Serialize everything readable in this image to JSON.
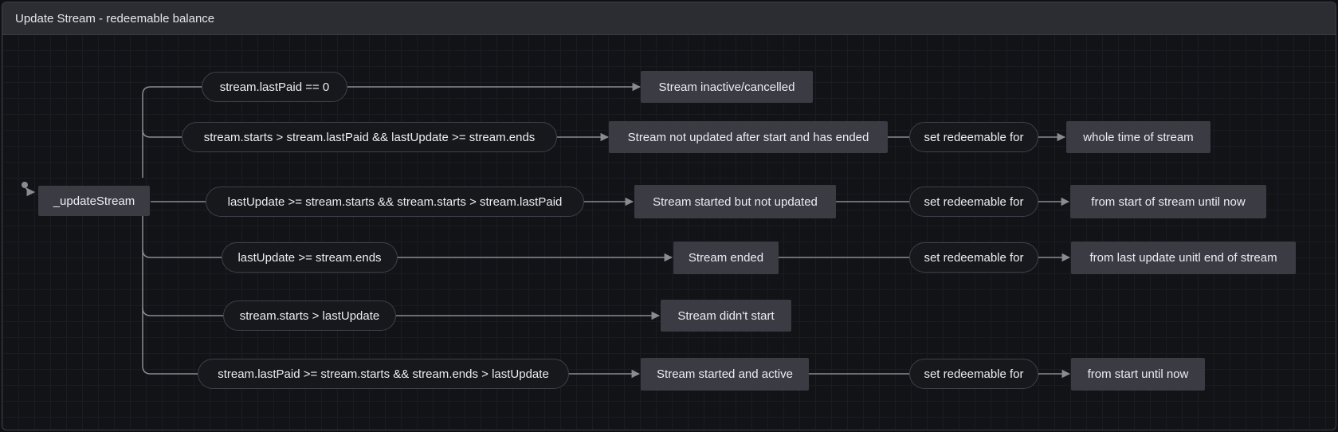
{
  "window": {
    "title": "Update Stream - redeemable balance"
  },
  "diagram": {
    "start_state": "_updateStream",
    "transitions": [
      {
        "condition": "stream.lastPaid == 0",
        "state": "Stream inactive/cancelled"
      },
      {
        "condition": "stream.starts > stream.lastPaid && lastUpdate >= stream.ends",
        "state": "Stream not updated after start and has ended",
        "action": "set redeemable for",
        "target": "whole time of stream"
      },
      {
        "condition": "lastUpdate >= stream.starts && stream.starts > stream.lastPaid",
        "state": "Stream started but not updated",
        "action": "set redeemable for",
        "target": "from start of stream until now"
      },
      {
        "condition": "lastUpdate >= stream.ends",
        "state": "Stream ended",
        "action": "set redeemable for",
        "target": "from last update unitl end of stream"
      },
      {
        "condition": "stream.starts > lastUpdate",
        "state": "Stream didn't start"
      },
      {
        "condition": "stream.lastPaid >= stream.starts && stream.ends > lastUpdate",
        "state": "Stream started and active",
        "action": "set redeemable for",
        "target": "from start until now"
      }
    ]
  }
}
